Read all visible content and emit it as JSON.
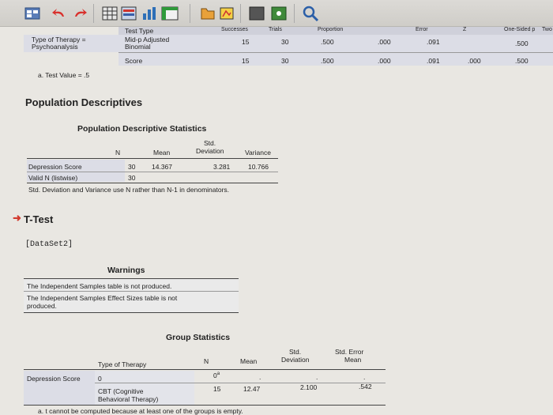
{
  "toolbar": {
    "icons": [
      "spreadsheet-icon",
      "undo-icon",
      "redo-icon",
      "data-grid-icon",
      "variables-icon",
      "bar-chart-icon",
      "pivot-icon",
      "export-icon",
      "stop-icon",
      "run-icon",
      "search-icon"
    ]
  },
  "binomial": {
    "headers": [
      "Test Type",
      "Successes",
      "Trials",
      "Proportion",
      "Error",
      "Z",
      "One-Sided p",
      "Two"
    ],
    "row1": {
      "group": "Type of Therapy = Psychoanalysis",
      "test": "Mid-p Adjusted Binomial",
      "successes": "15",
      "trials": "30",
      "proportion": ".500",
      "error": ".000",
      "z": ".091",
      "one_sided": ".500"
    },
    "row2": {
      "test": "Score",
      "successes": "15",
      "trials": "30",
      "proportion": ".500",
      "error": ".000",
      "z": ".091",
      "extra": ".000",
      "one_sided": ".500"
    },
    "footnote": "a. Test Value = .5"
  },
  "pop": {
    "section_title": "Population Descriptives",
    "table_title": "Population Descriptive Statistics",
    "headers": {
      "n": "N",
      "mean": "Mean",
      "std_line1": "Std.",
      "std_line2": "Deviation",
      "variance": "Variance"
    },
    "row1": {
      "label": "Depression Score",
      "n": "30",
      "mean": "14.367",
      "std": "3.281",
      "variance": "10.766"
    },
    "row2": {
      "label": "Valid N (listwise)",
      "n": "30"
    },
    "footnote": "Std. Deviation and Variance use N rather than N-1 in denominators."
  },
  "ttest": {
    "section_title": "T-Test",
    "dataset": "[DataSet2]",
    "warnings_title": "Warnings",
    "warning1": "The Independent Samples table is not produced.",
    "warning2_line1": "The Independent Samples Effect Sizes table is not",
    "warning2_line2": "produced."
  },
  "group": {
    "title": "Group Statistics",
    "headers": {
      "type": "Type of Therapy",
      "n": "N",
      "mean": "Mean",
      "std_line1": "Std.",
      "std_line2": "Deviation",
      "se_line1": "Std. Error",
      "se_line2": "Mean"
    },
    "row_label": "Depression Score",
    "row1": {
      "type": "0",
      "n": "0",
      "n_sup": "a",
      "mean": ".",
      "std": ".",
      "se": "."
    },
    "row2": {
      "type_line1": "CBT (Cognitive",
      "type_line2": "Behavioral Therapy)",
      "n": "15",
      "mean": "12.47",
      "std": "2.100",
      "se": ".542"
    },
    "footnote": "a. t cannot be computed because at least one of the groups is empty."
  }
}
